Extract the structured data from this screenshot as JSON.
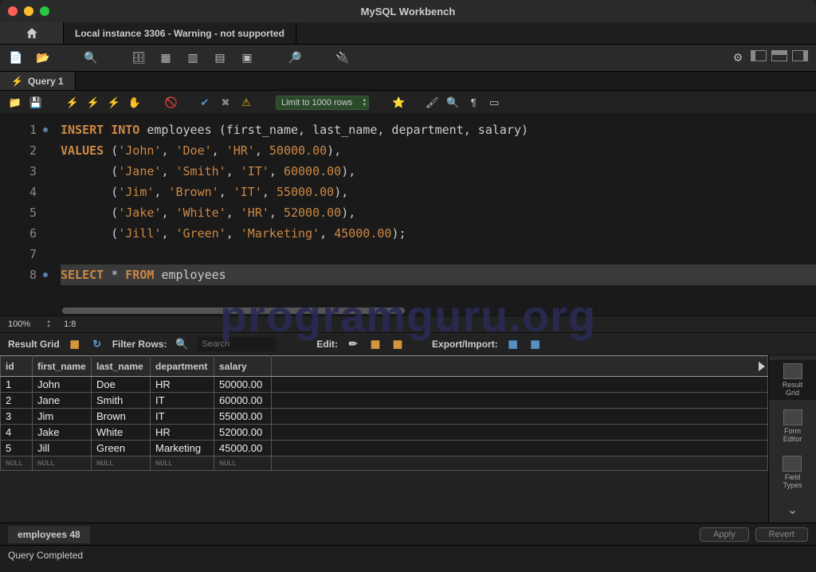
{
  "window": {
    "title": "MySQL Workbench"
  },
  "tabs": {
    "connection": "Local instance 3306 - Warning - not supported"
  },
  "query_tab": {
    "label": "Query 1"
  },
  "editor_toolbar": {
    "limit_label": "Limit to 1000 rows"
  },
  "code": {
    "lines": [
      1,
      2,
      3,
      4,
      5,
      6,
      7,
      8
    ],
    "line1": {
      "kw1": "INSERT",
      "kw2": "INTO",
      "ident1": "employees",
      "rest": "(first_name, last_name, department, salary)"
    },
    "line2": {
      "kw": "VALUES",
      "s1": "'John'",
      "s2": "'Doe'",
      "s3": "'HR'",
      "n": "50000.00"
    },
    "line3": {
      "s1": "'Jane'",
      "s2": "'Smith'",
      "s3": "'IT'",
      "n": "60000.00"
    },
    "line4": {
      "s1": "'Jim'",
      "s2": "'Brown'",
      "s3": "'IT'",
      "n": "55000.00"
    },
    "line5": {
      "s1": "'Jake'",
      "s2": "'White'",
      "s3": "'HR'",
      "n": "52000.00"
    },
    "line6": {
      "s1": "'Jill'",
      "s2": "'Green'",
      "s3": "'Marketing'",
      "n": "45000.00"
    },
    "line8": {
      "kw1": "SELECT",
      "star": "*",
      "kw2": "FROM",
      "ident": "employees"
    }
  },
  "footer": {
    "zoom": "100%",
    "cursor": "1:8"
  },
  "result_toolbar": {
    "title": "Result Grid",
    "filter_label": "Filter Rows:",
    "filter_placeholder": "Search",
    "edit_label": "Edit:",
    "export_label": "Export/Import:"
  },
  "grid": {
    "columns": [
      "id",
      "first_name",
      "last_name",
      "department",
      "salary"
    ],
    "rows": [
      {
        "id": "1",
        "first_name": "John",
        "last_name": "Doe",
        "department": "HR",
        "salary": "50000.00"
      },
      {
        "id": "2",
        "first_name": "Jane",
        "last_name": "Smith",
        "department": "IT",
        "salary": "60000.00"
      },
      {
        "id": "3",
        "first_name": "Jim",
        "last_name": "Brown",
        "department": "IT",
        "salary": "55000.00"
      },
      {
        "id": "4",
        "first_name": "Jake",
        "last_name": "White",
        "department": "HR",
        "salary": "52000.00"
      },
      {
        "id": "5",
        "first_name": "Jill",
        "last_name": "Green",
        "department": "Marketing",
        "salary": "45000.00"
      }
    ],
    "null_label": "NULL"
  },
  "sidepanel": {
    "result_grid": "Result\nGrid",
    "form_editor": "Form\nEditor",
    "field_types": "Field\nTypes"
  },
  "bottom": {
    "tab_label": "employees 48",
    "apply": "Apply",
    "revert": "Revert"
  },
  "status": {
    "text": "Query Completed"
  },
  "watermark": "programguru.org"
}
